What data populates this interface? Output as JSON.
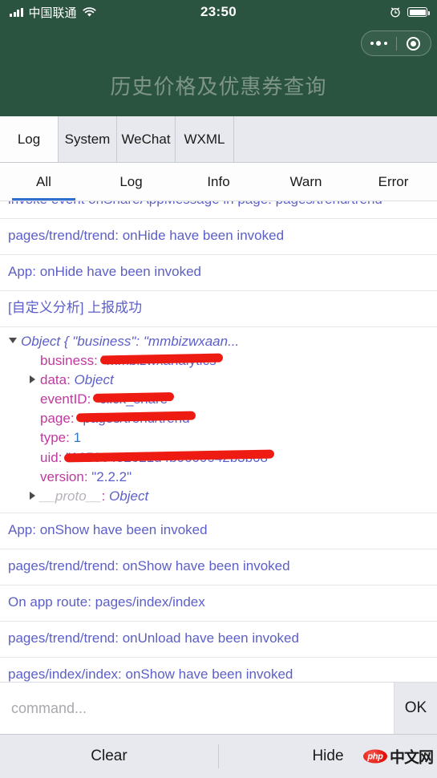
{
  "status_bar": {
    "carrier": "中国联通",
    "time": "23:50",
    "signal_icon": "signal-bars-icon",
    "wifi_icon": "wifi-icon",
    "alarm_icon": "alarm-clock-icon",
    "battery_icon": "battery-full-icon"
  },
  "nav": {
    "title": "历史价格及优惠券查询",
    "capsule": {
      "menu_icon": "more-dots-icon",
      "target_icon": "capsule-target-icon"
    }
  },
  "panel_tabs": [
    {
      "label": "Log",
      "active": true
    },
    {
      "label": "System",
      "active": false
    },
    {
      "label": "WeChat",
      "active": false
    },
    {
      "label": "WXML",
      "active": false
    }
  ],
  "filter_tabs": [
    {
      "label": "All",
      "active": true
    },
    {
      "label": "Log",
      "active": false
    },
    {
      "label": "Info",
      "active": false
    },
    {
      "label": "Warn",
      "active": false
    },
    {
      "label": "Error",
      "active": false
    }
  ],
  "log_entries": [
    {
      "type": "text",
      "text": "invoke event onShareAppMessage in page: pages/trend/trend",
      "clipped": true
    },
    {
      "type": "text",
      "text": "pages/trend/trend: onHide have been invoked"
    },
    {
      "type": "text",
      "text": "App: onHide have been invoked"
    },
    {
      "type": "text",
      "text": "[自定义分析] 上报成功"
    },
    {
      "type": "object",
      "header": "Object { \"business\": \"mmbizwxaan...",
      "properties": [
        {
          "name": "business",
          "value": "\"mmbizwxanalytics\"",
          "kind": "string",
          "redacted": true,
          "expandable": false
        },
        {
          "name": "data",
          "value": "Object",
          "kind": "type",
          "redacted": false,
          "expandable": true
        },
        {
          "name": "eventID",
          "value": "\"click_share\"",
          "kind": "string",
          "redacted": true,
          "expandable": false
        },
        {
          "name": "page",
          "value": "\"pages/trend/trend\"",
          "kind": "string",
          "redacted": true,
          "expandable": false
        },
        {
          "name": "type",
          "value": "1",
          "kind": "number",
          "redacted": false,
          "expandable": false
        },
        {
          "name": "uid",
          "value": "\"16566482621d4b0600042b3b08\"",
          "kind": "string",
          "redacted": true,
          "expandable": false
        },
        {
          "name": "version",
          "value": "\"2.2.2\"",
          "kind": "string",
          "redacted": false,
          "expandable": false
        },
        {
          "name": "__proto__",
          "value": "Object",
          "kind": "type",
          "redacted": false,
          "expandable": true,
          "proto": true
        }
      ]
    },
    {
      "type": "text",
      "text": "App: onShow have been invoked"
    },
    {
      "type": "text",
      "text": "pages/trend/trend: onShow have been invoked"
    },
    {
      "type": "text",
      "text": "On app route: pages/index/index"
    },
    {
      "type": "text",
      "text": "pages/trend/trend: onUnload have been invoked"
    },
    {
      "type": "text",
      "text": "pages/index/index: onShow have been invoked"
    }
  ],
  "command_bar": {
    "placeholder": "command...",
    "value": "",
    "ok_label": "OK"
  },
  "bottom_bar": {
    "clear_label": "Clear",
    "hide_label": "Hide",
    "watermark_badge": "php",
    "watermark_text": "中文网"
  },
  "colors": {
    "header_green": "#2b5440",
    "log_text": "#5c5fc7",
    "property_name": "#c0399f",
    "number_value": "#2f76c7",
    "redaction_red": "#ee1b12",
    "active_underline": "#2f6fd0"
  }
}
